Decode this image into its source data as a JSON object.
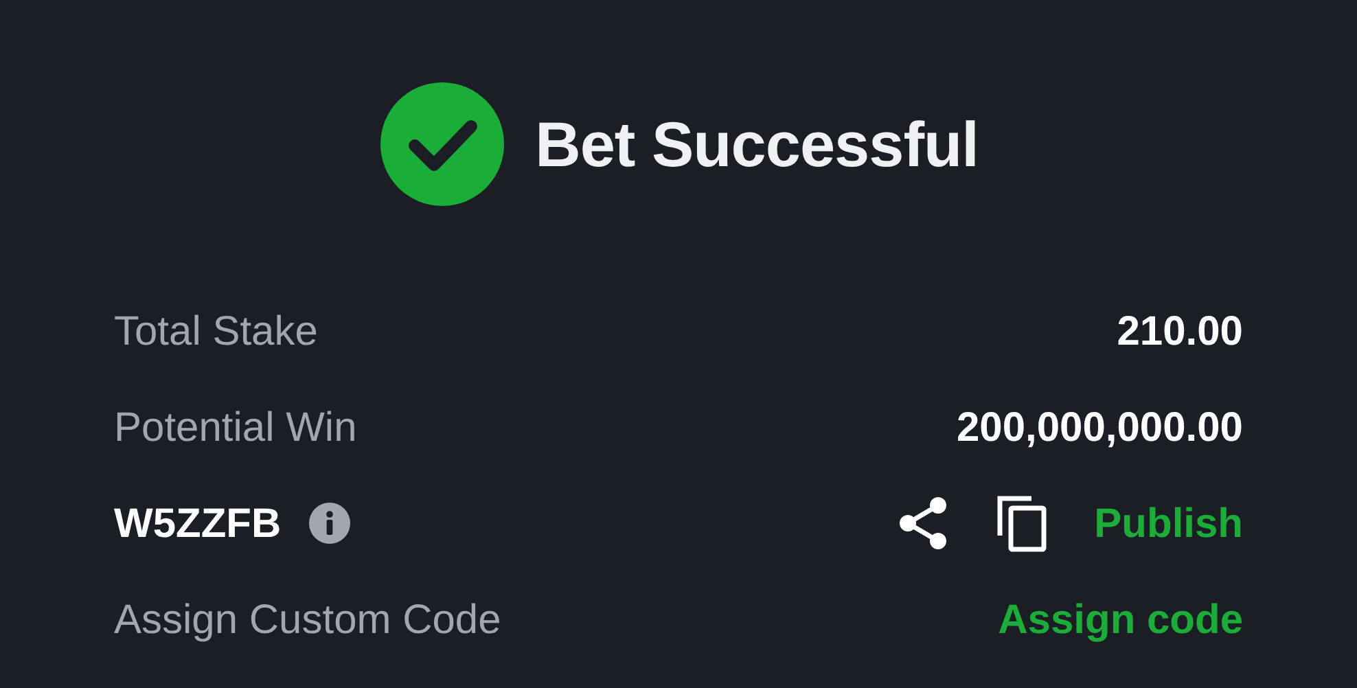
{
  "title": "Bet Successful",
  "summary": [
    {
      "label": "Total Stake",
      "value": "210.00"
    },
    {
      "label": "Potential Win",
      "value": "200,000,000.00"
    }
  ],
  "booking": {
    "code": "W5ZZFB",
    "action": "Publish"
  },
  "custom_code": {
    "label": "Assign Custom Code",
    "action": "Assign code"
  }
}
